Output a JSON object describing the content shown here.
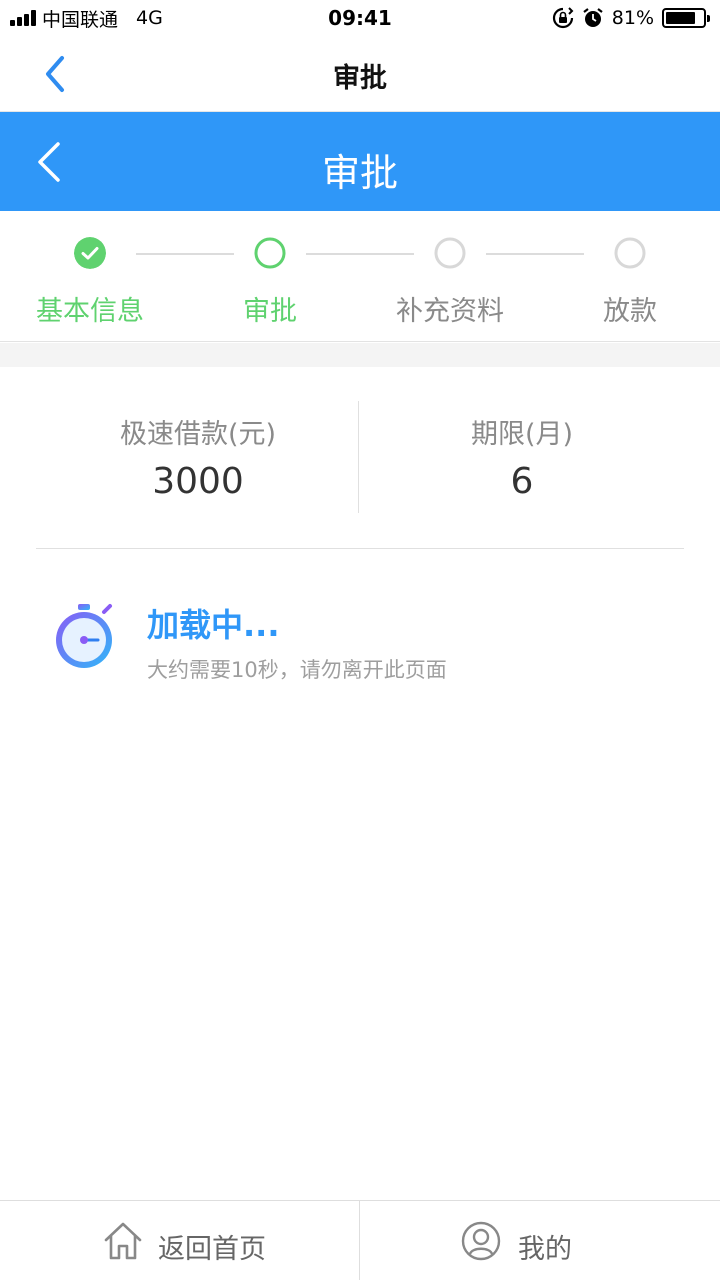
{
  "status_bar": {
    "carrier": "中国联通",
    "network": "4G",
    "time": "09:41",
    "battery_percent": "81%",
    "battery_level": 0.81
  },
  "nav": {
    "title": "审批"
  },
  "header": {
    "title": "审批",
    "color": "#2f97f8"
  },
  "steps": [
    {
      "label": "基本信息",
      "state": "done"
    },
    {
      "label": "审批",
      "state": "current"
    },
    {
      "label": "补充资料",
      "state": "pending"
    },
    {
      "label": "放款",
      "state": "pending"
    }
  ],
  "step_colors": {
    "done": "#5fd26f",
    "pending": "#dcdcdc",
    "pending_text": "#8a8a8a"
  },
  "loan_info": {
    "amount_label": "极速借款(元)",
    "amount_value": "3000",
    "term_label": "期限(月)",
    "term_value": "6"
  },
  "loading": {
    "icon": "stopwatch-icon",
    "title": "加载中...",
    "subtitle": "大约需要10秒，请勿离开此页面"
  },
  "bottom_bar": {
    "home_label": "返回首页",
    "home_icon": "home-icon",
    "mine_label": "我的",
    "mine_icon": "user-icon"
  }
}
